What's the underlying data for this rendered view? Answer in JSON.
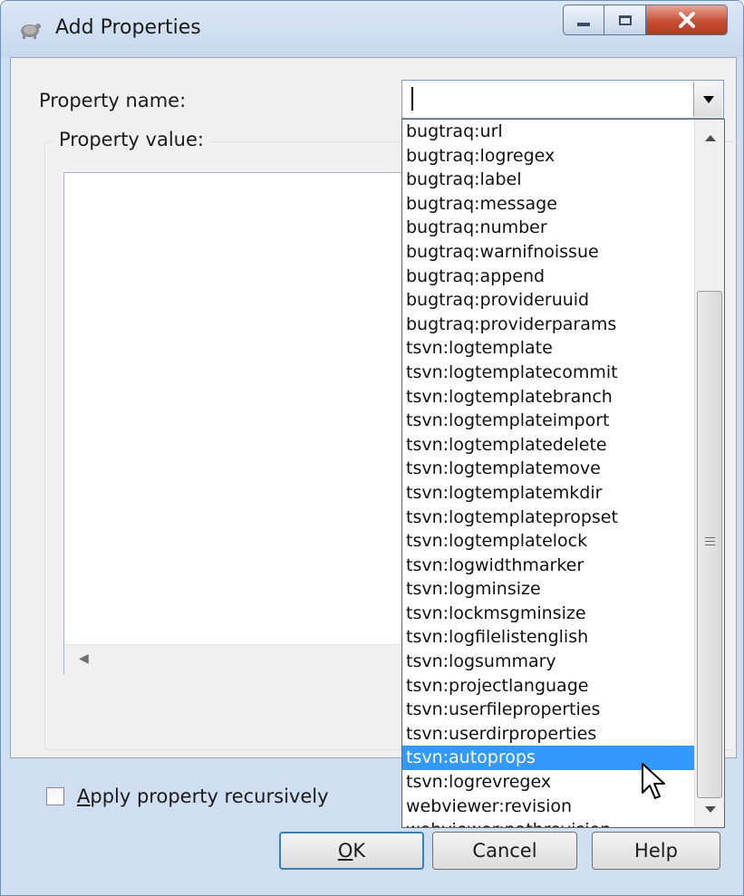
{
  "window": {
    "title": "Add Properties",
    "controls": [
      "minimize",
      "maximize",
      "close"
    ]
  },
  "form": {
    "property_name_label": "Property name:",
    "property_name_value": "",
    "property_value_label": "Property value:",
    "property_value_text": ""
  },
  "dropdown": {
    "selected_index": 26,
    "items": [
      "bugtraq:url",
      "bugtraq:logregex",
      "bugtraq:label",
      "bugtraq:message",
      "bugtraq:number",
      "bugtraq:warnifnoissue",
      "bugtraq:append",
      "bugtraq:provideruuid",
      "bugtraq:providerparams",
      "tsvn:logtemplate",
      "tsvn:logtemplatecommit",
      "tsvn:logtemplatebranch",
      "tsvn:logtemplateimport",
      "tsvn:logtemplatedelete",
      "tsvn:logtemplatemove",
      "tsvn:logtemplatemkdir",
      "tsvn:logtemplatepropset",
      "tsvn:logtemplatelock",
      "tsvn:logwidthmarker",
      "tsvn:logminsize",
      "tsvn:lockmsgminsize",
      "tsvn:logfilelistenglish",
      "tsvn:logsummary",
      "tsvn:projectlanguage",
      "tsvn:userfileproperties",
      "tsvn:userdirproperties",
      "tsvn:autoprops",
      "tsvn:logrevregex",
      "webviewer:revision",
      "webviewer:pathrevision"
    ]
  },
  "options": {
    "apply_recursive_prefix": "A",
    "apply_recursive_rest": "pply property recursively",
    "apply_recursive_checked": false
  },
  "buttons": {
    "ok_prefix": "O",
    "ok_rest": "K",
    "cancel": "Cancel",
    "help": "Help"
  },
  "colors": {
    "selection": "#3399ff",
    "title_bar": "#c6d8ee",
    "close_button": "#c44f34"
  }
}
